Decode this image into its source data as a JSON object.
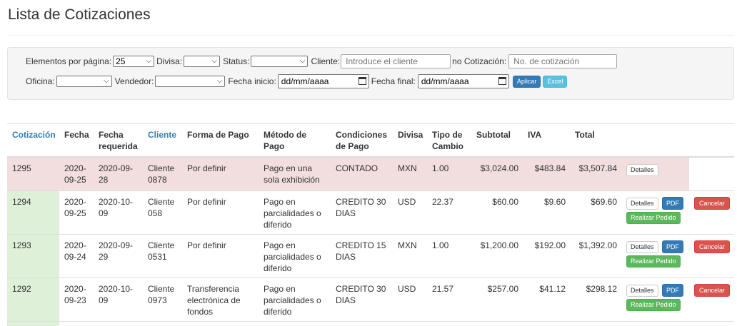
{
  "page": {
    "title": "Lista de Cotizaciones"
  },
  "filters": {
    "per_page_label": "Elementos por página:",
    "per_page_value": "25",
    "divisa_label": "Divisa:",
    "status_label": "Status:",
    "cliente_label": "Cliente:",
    "cliente_placeholder": "Introduce el cliente",
    "no_cotizacion_label": "no Cotización:",
    "no_cotizacion_placeholder": "No. de cotización",
    "oficina_label": "Oficina:",
    "vendedor_label": "Vendedor:",
    "fecha_inicio_label": "Fecha inicio:",
    "fecha_inicio_value": "dd/mm/aaaa",
    "fecha_final_label": "Fecha final:",
    "fecha_final_value": "dd/mm/aaaa",
    "aplicar_label": "Aplicar",
    "excel_label": "Excel"
  },
  "table": {
    "headers": {
      "cotizacion": "Cotización",
      "fecha": "Fecha",
      "fecha_requerida_1": "Fecha",
      "fecha_requerida_2": "requerida",
      "cliente": "Cliente",
      "forma_pago": "Forma de Pago",
      "metodo_pago_1": "Método de",
      "metodo_pago_2": "Pago",
      "condiciones_1": "Condiciones",
      "condiciones_2": "de Pago",
      "divisa": "Divisa",
      "tipo_cambio_1": "Tipo de",
      "tipo_cambio_2": "Cambio",
      "subtotal": "Subtotal",
      "iva": "IVA",
      "total": "Total"
    },
    "rows": [
      {
        "cotizacion": "1295",
        "fecha": [
          "2020-",
          "09-25"
        ],
        "fecha_requerida": [
          "2020-09-",
          "28"
        ],
        "cliente": [
          "Cliente",
          "0878"
        ],
        "forma_pago": [
          "Por definir"
        ],
        "metodo_pago": [
          "Pago en una",
          "sola exhibición"
        ],
        "condiciones": [
          "CONTADO"
        ],
        "divisa": "MXN",
        "tipo_cambio": "1.00",
        "subtotal": "$3,024.00",
        "iva": "$483.84",
        "total": "$3,507.84",
        "detalles_label": "Detalles"
      },
      {
        "cotizacion": "1294",
        "fecha": [
          "2020-",
          "09-25"
        ],
        "fecha_requerida": [
          "2020-10-",
          "09"
        ],
        "cliente": [
          "Cliente",
          "058"
        ],
        "forma_pago": [
          "Por definir"
        ],
        "metodo_pago": [
          "Pago en",
          "parcialidades o",
          "diferido"
        ],
        "condiciones": [
          "CREDITO 30",
          "DIAS"
        ],
        "divisa": "USD",
        "tipo_cambio": "22.37",
        "subtotal": "$60.00",
        "iva": "$9.60",
        "total": "$69.60",
        "detalles_label": "Detalles",
        "pdf_label": "PDF",
        "pedido_label": "Realizar Pedido",
        "cancelar_label": "Cancelar"
      },
      {
        "cotizacion": "1293",
        "fecha": [
          "2020-",
          "09-24"
        ],
        "fecha_requerida": [
          "2020-09-",
          "29"
        ],
        "cliente": [
          "Cliente",
          "0531"
        ],
        "forma_pago": [
          "Por definir"
        ],
        "metodo_pago": [
          "Pago en",
          "parcialidades o",
          "diferido"
        ],
        "condiciones": [
          "CREDITO 15",
          "DIAS"
        ],
        "divisa": "MXN",
        "tipo_cambio": "1.00",
        "subtotal": "$1,200.00",
        "iva": "$192.00",
        "total": "$1,392.00",
        "detalles_label": "Detalles",
        "pdf_label": "PDF",
        "pedido_label": "Realizar Pedido",
        "cancelar_label": "Cancelar"
      },
      {
        "cotizacion": "1292",
        "fecha": [
          "2020-",
          "09-23"
        ],
        "fecha_requerida": [
          "2020-10-",
          "09"
        ],
        "cliente": [
          "Cliente",
          "0973"
        ],
        "forma_pago": [
          "Transferencia",
          "electrónica de",
          "fondos"
        ],
        "metodo_pago": [
          "Pago en",
          "parcialidades o",
          "diferido"
        ],
        "condiciones": [
          "CREDITO 30",
          "DIAS"
        ],
        "divisa": "USD",
        "tipo_cambio": "21.57",
        "subtotal": "$257.00",
        "iva": "$41.12",
        "total": "$298.12",
        "detalles_label": "Detalles",
        "pdf_label": "PDF",
        "pedido_label": "Realizar Pedido",
        "cancelar_label": "Cancelar"
      }
    ]
  },
  "colors": {
    "link_blue": "#337ab7",
    "row_pending_pink": "#f2dede",
    "row_active_green": "#dff0d8",
    "btn_primary": "#337ab7",
    "btn_info": "#5bc0de",
    "btn_success": "#5cb85c",
    "btn_danger": "#d9534f"
  },
  "icons": {
    "dropdown": "chevron-down-icon",
    "calendar": "calendar-icon"
  }
}
